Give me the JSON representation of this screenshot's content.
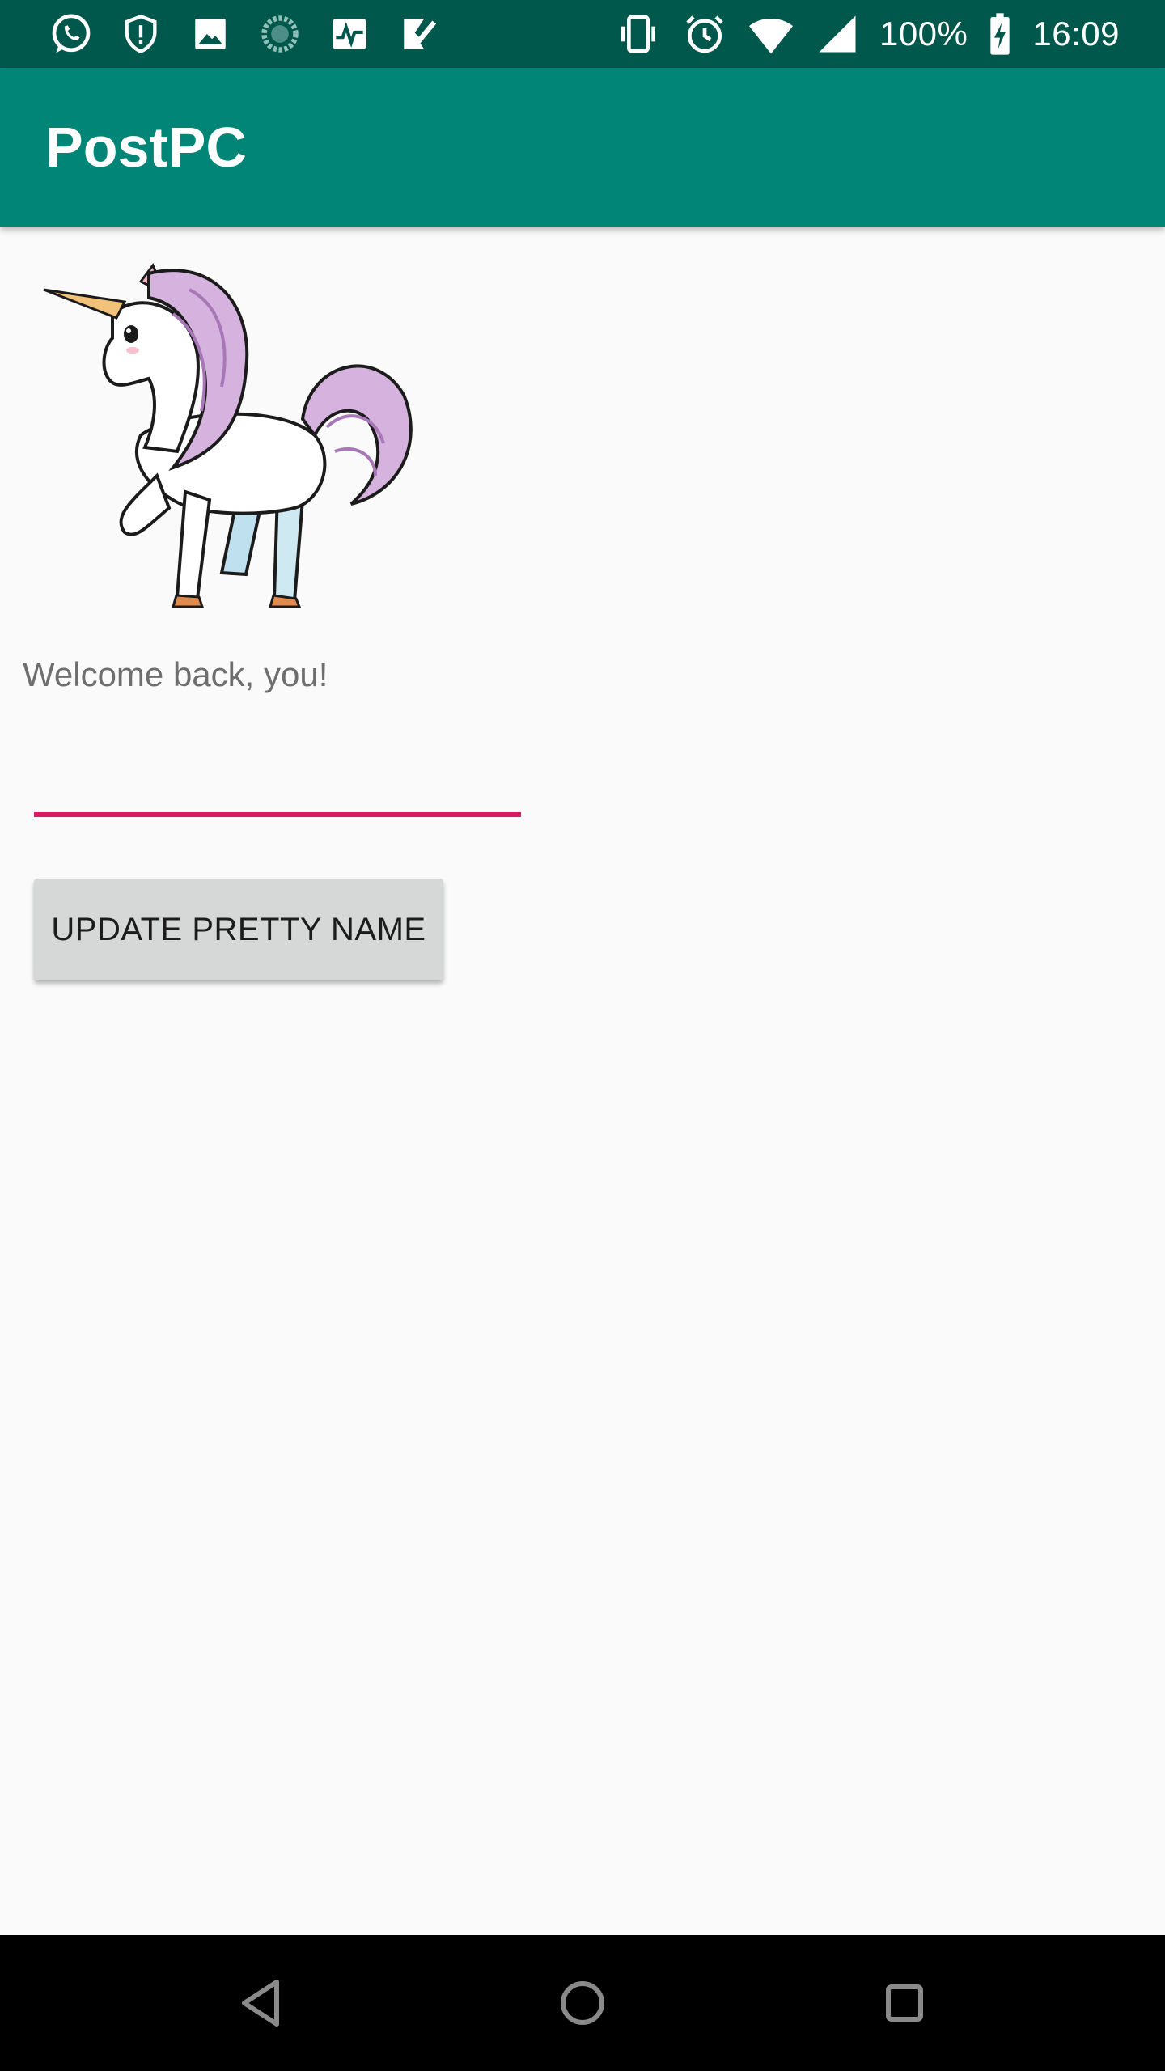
{
  "status_bar": {
    "left_icons": [
      "whatsapp-icon",
      "shield-alert-icon",
      "image-icon",
      "sync-icon",
      "activity-icon",
      "check-app-icon"
    ],
    "right_icons": [
      "vibrate-icon",
      "alarm-icon",
      "wifi-icon",
      "signal-icon",
      "battery-charging-icon"
    ],
    "battery": "100%",
    "time": "16:09"
  },
  "app_bar": {
    "title": "PostPC",
    "color": "#008577",
    "status_color": "#00574B"
  },
  "main": {
    "image_icon": "unicorn-illustration",
    "welcome_text": "Welcome back, you!",
    "name_input": {
      "value": "",
      "placeholder": "",
      "accent_color": "#D81B60"
    },
    "update_button_label": "UPDATE PRETTY NAME"
  },
  "nav_bar": {
    "items": [
      "back-icon",
      "home-icon",
      "recents-icon"
    ]
  }
}
